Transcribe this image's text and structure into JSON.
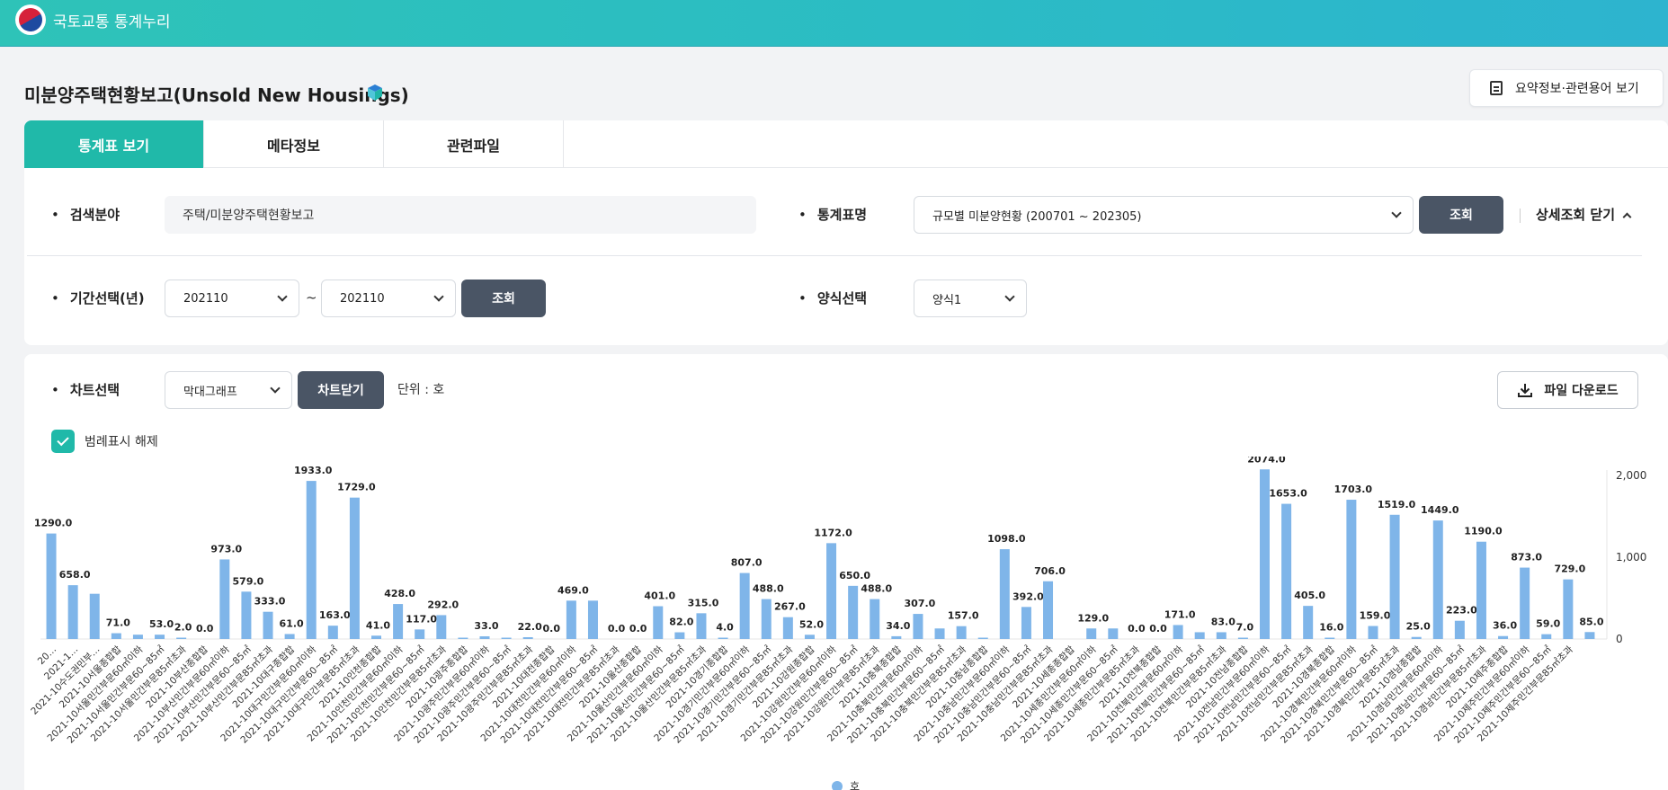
{
  "header": {
    "site_title": "국토교통 통계누리"
  },
  "page": {
    "title": "미분양주택현황보고(Unsold New Housings)",
    "summary_button": "요약정보·관련용어 보기"
  },
  "tabs": [
    {
      "label": "통계표 보기"
    },
    {
      "label": "메타정보"
    },
    {
      "label": "관련파일"
    }
  ],
  "search": {
    "field_label": "검색분야",
    "field_value": "주택/미분양주택현황보고",
    "table_label": "통계표명",
    "table_value": "규모별 미분양현황 (200701 ~ 202305)",
    "query_button": "조회",
    "detail_toggle": "상세조회 닫기",
    "period_label": "기간선택(년)",
    "period_from": "202110",
    "period_separator": "~",
    "period_to": "202110",
    "period_query_button": "조회",
    "format_label": "양식선택",
    "format_value": "양식1"
  },
  "chart_controls": {
    "label": "차트선택",
    "type_value": "막대그래프",
    "close_button": "차트닫기",
    "unit": "단위 : 호",
    "download_button": "파일 다운로드",
    "legend_toggle": "범례표시 해제"
  },
  "colors": {
    "accent": "#20b9a9",
    "bar": "#7fb5e9",
    "dark_button": "#4a5565"
  },
  "chart_data": {
    "type": "bar",
    "legend": [
      "호"
    ],
    "ylim": [
      0,
      2000
    ],
    "yticks": [
      "0",
      "1,000",
      "2,000"
    ],
    "categories": [
      "20…",
      "2021-1…",
      "2021-10수도권민부…",
      "2021-10서울종합합",
      "2021-10서울민간부문60㎡이하",
      "2021-10서울민간부문60~85㎡",
      "2021-10서울민간부문85㎡초과",
      "2021-10부산종합합",
      "2021-10부산민간부문60㎡이하",
      "2021-10부산민간부문60~85㎡",
      "2021-10부산민간부문85㎡초과",
      "2021-10대구종합합",
      "2021-10대구민간부문60㎡이하",
      "2021-10대구민간부문60~85㎡",
      "2021-10대구민간부문85㎡초과",
      "2021-10인천종합합",
      "2021-10인천민간부문60㎡이하",
      "2021-10인천민간부문60~85㎡",
      "2021-10인천민간부문85㎡초과",
      "2021-10광주종합합",
      "2021-10광주민간부문60㎡이하",
      "2021-10광주민간부문60~85㎡",
      "2021-10광주민간부문85㎡초과",
      "2021-10대전종합합",
      "2021-10대전민간부문60㎡이하",
      "2021-10대전민간부문60~85㎡",
      "2021-10대전민간부문85㎡초과",
      "2021-10울산종합합",
      "2021-10울산민간부문60㎡이하",
      "2021-10울산민간부문60~85㎡",
      "2021-10울산민간부문85㎡초과",
      "2021-10경기종합합",
      "2021-10경기민간부문60㎡이하",
      "2021-10경기민간부문60~85㎡",
      "2021-10경기민간부문85㎡초과",
      "2021-10강원종합합",
      "2021-10강원민간부문60㎡이하",
      "2021-10강원민간부문60~85㎡",
      "2021-10강원민간부문85㎡초과",
      "2021-10충북종합합",
      "2021-10충북민간부문60㎡이하",
      "2021-10충북민간부문60~85㎡",
      "2021-10충북민간부문85㎡초과",
      "2021-10충남종합합",
      "2021-10충남민간부문60㎡이하",
      "2021-10충남민간부문60~85㎡",
      "2021-10충남민간부문85㎡초과",
      "2021-10세종종합합",
      "2021-10세종민간부문60㎡이하",
      "2021-10세종민간부문60~85㎡",
      "2021-10세종민간부문85㎡초과",
      "2021-10전북종합합",
      "2021-10전북민간부문60㎡이하",
      "2021-10전북민간부문60~85㎡",
      "2021-10전북민간부문85㎡초과",
      "2021-10전남종합합",
      "2021-10전남민간부문60㎡이하",
      "2021-10전남민간부문60~85㎡",
      "2021-10전남민간부문85㎡초과",
      "2021-10경북종합합",
      "2021-10경북민간부문60㎡이하",
      "2021-10경북민간부문60~85㎡",
      "2021-10경북민간부문85㎡초과",
      "2021-10경남종합합",
      "2021-10경남민간부문60㎡이하",
      "2021-10경남민간부문60~85㎡",
      "2021-10경남민간부문85㎡초과",
      "2021-10제주종합합",
      "2021-10제주민간부문60㎡이하",
      "2021-10제주민간부문60~85㎡",
      "2021-10제주민간부문85㎡초과"
    ],
    "values": [
      1290,
      658,
      553,
      71,
      53,
      53,
      2,
      0,
      973,
      579,
      333,
      61,
      1933,
      163,
      1729,
      41,
      428,
      117,
      292,
      8,
      33,
      15,
      22,
      0,
      469,
      469,
      0,
      0,
      401,
      82,
      315,
      4,
      807,
      488,
      267,
      52,
      1172,
      650,
      488,
      34,
      307,
      129,
      157,
      15,
      1098,
      392,
      706,
      0,
      129,
      129,
      0,
      0,
      171,
      83,
      83,
      7,
      2074,
      1653,
      405,
      16,
      1703,
      159,
      1519,
      25,
      1449,
      223,
      1190,
      36,
      873,
      59,
      729,
      85
    ],
    "labels": [
      "1290.0",
      "658.0",
      "",
      "71.0",
      "",
      "53.0",
      "2.0",
      "0.0",
      "973.0",
      "579.0",
      "333.0",
      "61.0",
      "1933.0",
      "163.0",
      "1729.0",
      "41.0",
      "428.0",
      "117.0",
      "292.0",
      "",
      "33.0",
      "",
      "22.0",
      "0.0",
      "469.0",
      "",
      "0.0",
      "0.0",
      "401.0",
      "82.0",
      "315.0",
      "4.0",
      "807.0",
      "488.0",
      "267.0",
      "52.0",
      "1172.0",
      "650.0",
      "488.0",
      "34.0",
      "307.0",
      "",
      "157.0",
      "",
      "1098.0",
      "392.0",
      "706.0",
      "",
      "129.0",
      "",
      "0.0",
      "0.0",
      "171.0",
      "",
      "83.0",
      "7.0",
      "2074.0",
      "1653.0",
      "405.0",
      "16.0",
      "1703.0",
      "159.0",
      "1519.0",
      "25.0",
      "1449.0",
      "223.0",
      "1190.0",
      "36.0",
      "873.0",
      "59.0",
      "729.0",
      "85.0"
    ]
  }
}
